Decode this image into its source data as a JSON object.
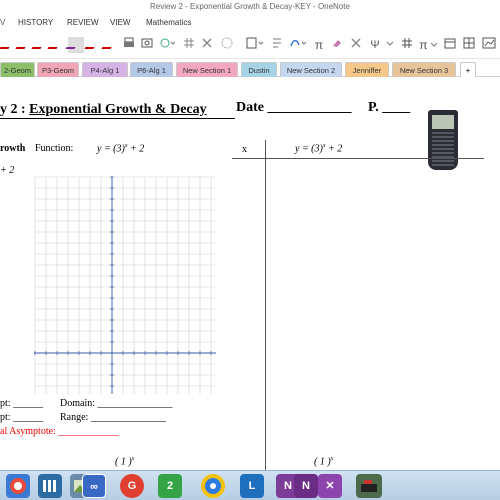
{
  "window": {
    "title": "Review 2 - Exponential Growth & Decay-KEY - OneNote"
  },
  "menu": {
    "items": [
      "HISTORY",
      "REVIEW",
      "VIEW",
      "Mathematics"
    ]
  },
  "toolbar": {
    "pi1": "π",
    "pi2": "π",
    "psi": "Ψ"
  },
  "sections": [
    {
      "label": "2-Geom",
      "color": "#8bbf6a"
    },
    {
      "label": "P3-Geom",
      "color": "#f0a6b4"
    },
    {
      "label": "P4-Alg 1",
      "color": "#d5b3e6"
    },
    {
      "label": "P6-Alg 1",
      "color": "#b4c8e8"
    },
    {
      "label": "New Section 1",
      "color": "#f3a8bf"
    },
    {
      "label": "Dustin",
      "color": "#a7d3e6"
    },
    {
      "label": "New Section 2",
      "color": "#c4d7ef"
    },
    {
      "label": "Jenniffer",
      "color": "#f5c889"
    },
    {
      "label": "New Section 3",
      "color": "#e8c49a"
    },
    {
      "label": "+",
      "color": "#ffffff"
    }
  ],
  "doc": {
    "title_partial": "y 2 :",
    "title_main": "Exponential Growth & Decay",
    "date_label": "Date",
    "date_blank": "____________",
    "period_label": "P.",
    "period_blank": "____",
    "function_prefix": "rowth",
    "function_label": "Function:",
    "eq_lhs": "y = (3)",
    "eq_exp": "x",
    "eq_rhs": " + 2",
    "left_eq_partial": "+ 2",
    "table_x": "x",
    "intercept1": "pt:",
    "intercept1_blank": "______",
    "intercept2": "pt:",
    "intercept2_blank": "______",
    "domain_label": "Domain:",
    "domain_blank": "_______________",
    "range_label": "Range:",
    "range_blank": "_______________",
    "asymptote_label": "al Asymptote:",
    "asymptote_blank": "____________",
    "bottom_frac_left": "( 1 )",
    "bottom_frac_right": "( 1 )",
    "bottom_exp": "x"
  },
  "colors": {
    "accent_red": "#e00000",
    "onenote_purple": "#7d3c98"
  },
  "taskbar": {
    "items": [
      {
        "icon": "chrome-like-icon",
        "label": ""
      },
      {
        "icon": "library-icon",
        "label": ""
      },
      {
        "icon": "image-viewer-icon",
        "label": ""
      },
      {
        "icon": "infinity-icon",
        "label": "∞"
      },
      {
        "icon": "google-chrome-icon",
        "label": "G"
      },
      {
        "icon": "app-2-icon",
        "label": "2"
      },
      {
        "icon": "camera-icon",
        "label": ""
      },
      {
        "icon": "lync-icon",
        "label": "L"
      },
      {
        "icon": "onenote-icon",
        "label": "N"
      },
      {
        "icon": "onenote-2-icon",
        "label": "N"
      },
      {
        "icon": "app-x-icon",
        "label": "✕"
      },
      {
        "icon": "document-camera-icon",
        "label": ""
      }
    ]
  }
}
